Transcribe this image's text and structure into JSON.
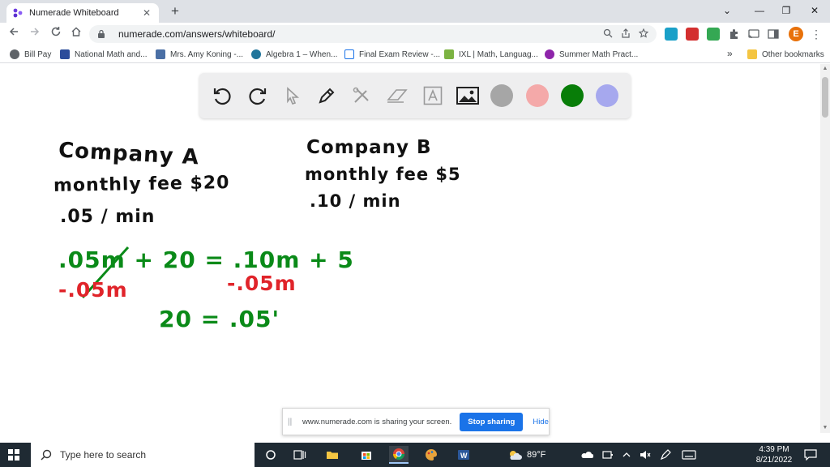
{
  "browser": {
    "tab_title": "Numerade Whiteboard",
    "close_glyph": "✕",
    "new_tab_glyph": "+",
    "url": "numerade.com/answers/whiteboard/",
    "profile_initial": "E",
    "window_controls": {
      "collapse": "⌄",
      "minimize": "—",
      "restore": "❐",
      "close": "✕"
    }
  },
  "bookmarks": {
    "items": [
      {
        "label": "Bill Pay",
        "icon": "globe-icon",
        "color": "#5f6368"
      },
      {
        "label": "National Math and...",
        "icon": "x-logo-icon",
        "color": "#2b4c9b"
      },
      {
        "label": "Mrs. Amy Koning -...",
        "icon": "page-icon",
        "color": "#4a6fa5"
      },
      {
        "label": "Algebra 1 – When...",
        "icon": "wordpress-icon",
        "color": "#21759b"
      },
      {
        "label": "Final Exam Review -...",
        "icon": "calendar-icon",
        "color": "#1a73e8"
      },
      {
        "label": "IXL | Math, Languag...",
        "icon": "ixl-icon",
        "color": "#7cb342"
      },
      {
        "label": "Summer Math Pract...",
        "icon": "circle-logo-icon",
        "color": "#8e24aa"
      }
    ],
    "more": "»",
    "other": "Other bookmarks"
  },
  "whiteboard": {
    "tools": [
      "undo-icon",
      "redo-icon",
      "select-arrow-icon",
      "pen-icon",
      "tools-icon",
      "eraser-icon",
      "text-icon",
      "image-icon"
    ],
    "colors": [
      "#a6a6a6",
      "#f4a9a9",
      "#087d08",
      "#a6a8ee"
    ],
    "writing": {
      "company_a_title": "Company A",
      "company_a_fee": "monthly fee $20",
      "company_a_rate": ".05 / min",
      "company_b_title": "Company B",
      "company_b_fee": "monthly fee $5",
      "company_b_rate": ".10 / min",
      "equation_main": ".05m + 20 = .10m + 5",
      "subtract_left": "-.05m",
      "subtract_right": "-.05m",
      "result": "20 = .05'"
    }
  },
  "share_bar": {
    "handle": "||",
    "message": "www.numerade.com is sharing your screen.",
    "stop_label": "Stop sharing",
    "hide_label": "Hide"
  },
  "taskbar": {
    "search_placeholder": "Type here to search",
    "weather": "89°F",
    "time": "4:39 PM",
    "date": "8/21/2022"
  }
}
